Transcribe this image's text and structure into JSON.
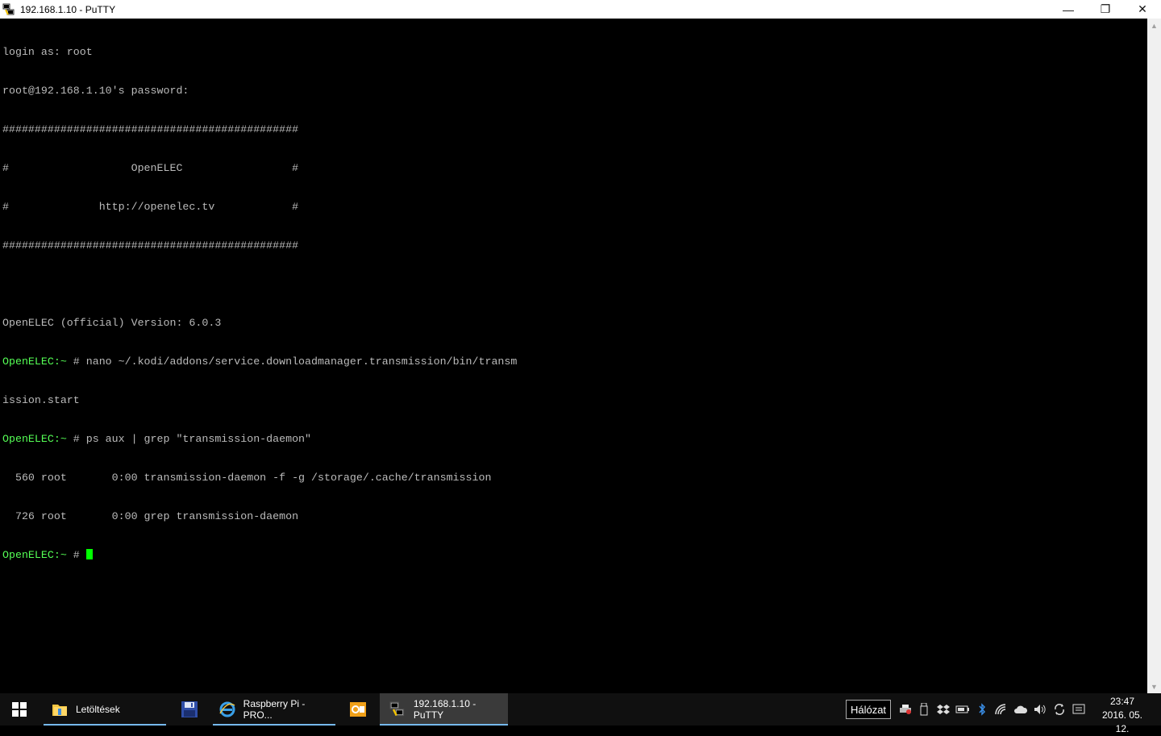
{
  "window": {
    "title": "192.168.1.10 - PuTTY",
    "controls": {
      "minimize": "—",
      "maximize": "❐",
      "close": "✕"
    }
  },
  "terminal": {
    "lines": [
      {
        "prompt": "",
        "text": "login as: root"
      },
      {
        "prompt": "",
        "text": "root@192.168.1.10's password:"
      },
      {
        "prompt": "",
        "text": "##############################################"
      },
      {
        "prompt": "",
        "text": "#                   OpenELEC                 #"
      },
      {
        "prompt": "",
        "text": "#              http://openelec.tv            #"
      },
      {
        "prompt": "",
        "text": "##############################################"
      },
      {
        "prompt": "",
        "text": ""
      },
      {
        "prompt": "",
        "text": "OpenELEC (official) Version: 6.0.3"
      },
      {
        "prompt": "OpenELEC:~",
        "text": " # nano ~/.kodi/addons/service.downloadmanager.transmission/bin/transm"
      },
      {
        "prompt": "",
        "text": "ission.start"
      },
      {
        "prompt": "OpenELEC:~",
        "text": " # ps aux | grep \"transmission-daemon\""
      },
      {
        "prompt": "",
        "text": "  560 root       0:00 transmission-daemon -f -g /storage/.cache/transmission"
      },
      {
        "prompt": "",
        "text": "  726 root       0:00 grep transmission-daemon"
      },
      {
        "prompt": "OpenELEC:~",
        "text": " # "
      }
    ],
    "colors": {
      "text": "#bbbbbb",
      "prompt": "#55ff55",
      "cursor": "#00ff00",
      "background": "#000000"
    }
  },
  "taskbar": {
    "tasks": [
      {
        "label": "Letöltések",
        "icon": "folder-icon"
      },
      {
        "label": "",
        "icon": "floppy-disk-icon"
      },
      {
        "label": "Raspberry Pi - PRO...",
        "icon": "internet-explorer-icon"
      },
      {
        "label": "",
        "icon": "outlook-icon"
      },
      {
        "label": "192.168.1.10 - PuTTY",
        "icon": "putty-icon"
      }
    ],
    "network_tooltip": "Hálózat",
    "clock": {
      "time": "23:47",
      "date": "2016. 05. 12."
    },
    "accent": "#76b9ed"
  }
}
